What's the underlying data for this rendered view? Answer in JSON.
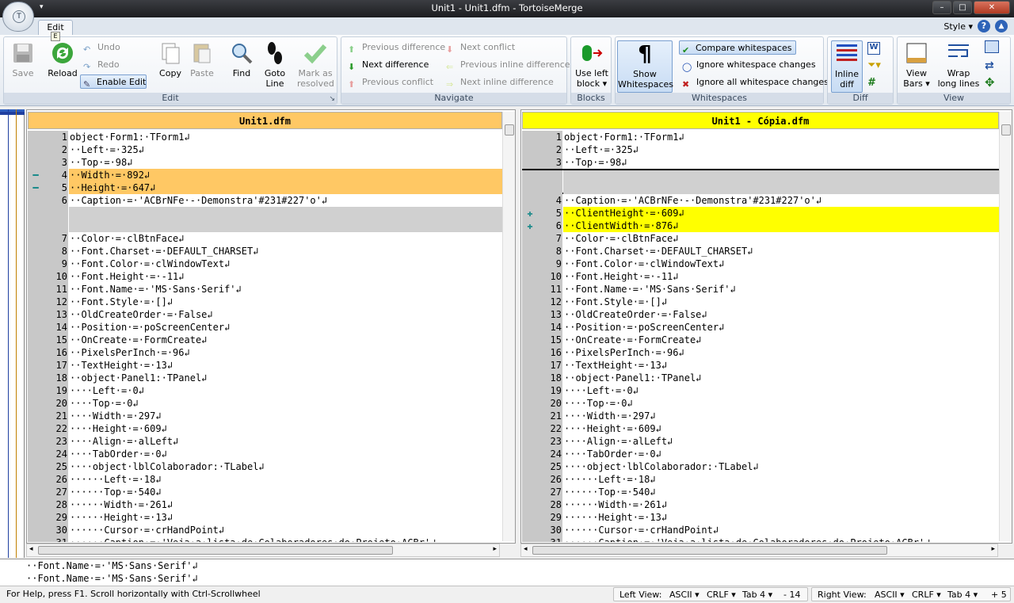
{
  "window": {
    "title": "Unit1 - Unit1.dfm - TortoiseMerge",
    "minimize": "–",
    "maximize": "□",
    "close": "✕"
  },
  "app_button": {
    "letter": "T",
    "qat": "▾"
  },
  "tabs": {
    "edit": "Edit",
    "keytip": "E"
  },
  "style_menu": "Style ▾",
  "ribbon": {
    "edit": {
      "label": "Edit",
      "save": "Save",
      "reload": "Reload",
      "undo": "Undo",
      "redo": "Redo",
      "enable_edit": "Enable Edit",
      "copy": "Copy",
      "paste": "Paste",
      "find": "Find",
      "goto": "Goto",
      "goto2": "Line",
      "mark": "Mark as",
      "mark2": "resolved",
      "launcher": "↘"
    },
    "navigate": {
      "label": "Navigate",
      "prev_diff": "Previous difference",
      "next_diff": "Next difference",
      "prev_conflict": "Previous conflict",
      "next_conflict": "Next conflict",
      "prev_inline": "Previous inline difference",
      "next_inline": "Next inline difference"
    },
    "blocks": {
      "label": "Blocks",
      "use_left": "Use left",
      "use_left2": "block ▾"
    },
    "whitespaces": {
      "label": "Whitespaces",
      "show": "Show",
      "show2": "Whitespaces",
      "compare": "Compare whitespaces",
      "ignore_changes": "Ignore whitespace changes",
      "ignore_all": "Ignore all whitespace changes"
    },
    "diff": {
      "label": "Diff",
      "inline": "Inline",
      "inline2": "diff"
    },
    "view": {
      "label": "View",
      "viewbars": "View",
      "viewbars2": "Bars ▾",
      "wrap": "Wrap",
      "wrap2": "long lines"
    }
  },
  "left_pane": {
    "filename": "Unit1.dfm",
    "lines": [
      {
        "n": "1",
        "t": "object·Form1:·TForm1↲",
        "k": "n"
      },
      {
        "n": "2",
        "t": "··Left·=·325↲",
        "k": "n"
      },
      {
        "n": "3",
        "t": "··Top·=·98↲",
        "k": "n"
      },
      {
        "n": "4",
        "t": "··Width·=·892↲",
        "k": "r",
        "m": "━"
      },
      {
        "n": "5",
        "t": "··Height·=·647↲",
        "k": "r",
        "m": "━"
      },
      {
        "n": "6",
        "t": "··Caption·=·'ACBrNFe·-·Demonstra'#231#227'o'↲",
        "k": "n"
      },
      {
        "n": "",
        "t": "",
        "k": "f"
      },
      {
        "n": "",
        "t": "",
        "k": "f"
      },
      {
        "n": "7",
        "t": "··Color·=·clBtnFace↲",
        "k": "n"
      },
      {
        "n": "8",
        "t": "··Font.Charset·=·DEFAULT_CHARSET↲",
        "k": "n"
      },
      {
        "n": "9",
        "t": "··Font.Color·=·clWindowText↲",
        "k": "n"
      },
      {
        "n": "10",
        "t": "··Font.Height·=·-11↲",
        "k": "n"
      },
      {
        "n": "11",
        "t": "··Font.Name·=·'MS·Sans·Serif'↲",
        "k": "n"
      },
      {
        "n": "12",
        "t": "··Font.Style·=·[]↲",
        "k": "n"
      },
      {
        "n": "13",
        "t": "··OldCreateOrder·=·False↲",
        "k": "n"
      },
      {
        "n": "14",
        "t": "··Position·=·poScreenCenter↲",
        "k": "n"
      },
      {
        "n": "15",
        "t": "··OnCreate·=·FormCreate↲",
        "k": "n"
      },
      {
        "n": "16",
        "t": "··PixelsPerInch·=·96↲",
        "k": "n"
      },
      {
        "n": "17",
        "t": "··TextHeight·=·13↲",
        "k": "n"
      },
      {
        "n": "18",
        "t": "··object·Panel1:·TPanel↲",
        "k": "n"
      },
      {
        "n": "19",
        "t": "····Left·=·0↲",
        "k": "n"
      },
      {
        "n": "20",
        "t": "····Top·=·0↲",
        "k": "n"
      },
      {
        "n": "21",
        "t": "····Width·=·297↲",
        "k": "n"
      },
      {
        "n": "22",
        "t": "····Height·=·609↲",
        "k": "n"
      },
      {
        "n": "23",
        "t": "····Align·=·alLeft↲",
        "k": "n"
      },
      {
        "n": "24",
        "t": "····TabOrder·=·0↲",
        "k": "n"
      },
      {
        "n": "25",
        "t": "····object·lblColaborador:·TLabel↲",
        "k": "n"
      },
      {
        "n": "26",
        "t": "······Left·=·18↲",
        "k": "n"
      },
      {
        "n": "27",
        "t": "······Top·=·540↲",
        "k": "n"
      },
      {
        "n": "28",
        "t": "······Width·=·261↲",
        "k": "n"
      },
      {
        "n": "29",
        "t": "······Height·=·13↲",
        "k": "n"
      },
      {
        "n": "30",
        "t": "······Cursor·=·crHandPoint↲",
        "k": "n"
      },
      {
        "n": "31",
        "t": "······Caption·=·'Veja·a·lista·de·Colaboradores·do·Projeto·ACBr'↲",
        "k": "n"
      }
    ]
  },
  "right_pane": {
    "filename": "Unit1 - Cópia.dfm",
    "lines": [
      {
        "n": "1",
        "t": "object·Form1:·TForm1↲",
        "k": "n"
      },
      {
        "n": "2",
        "t": "··Left·=·325↲",
        "k": "n"
      },
      {
        "n": "3",
        "t": "··Top·=·98↲",
        "k": "n"
      },
      {
        "n": "",
        "t": "",
        "k": "f"
      },
      {
        "n": "",
        "t": "",
        "k": "f"
      },
      {
        "n": "4",
        "t": "··Caption·=·'ACBrNFe·-·Demonstra'#231#227'o'↲",
        "k": "n"
      },
      {
        "n": "5",
        "t": "··ClientHeight·=·609↲",
        "k": "a",
        "m": "✚"
      },
      {
        "n": "6",
        "t": "··ClientWidth·=·876↲",
        "k": "a",
        "m": "✚"
      },
      {
        "n": "7",
        "t": "··Color·=·clBtnFace↲",
        "k": "n"
      },
      {
        "n": "8",
        "t": "··Font.Charset·=·DEFAULT_CHARSET↲",
        "k": "n"
      },
      {
        "n": "9",
        "t": "··Font.Color·=·clWindowText↲",
        "k": "n"
      },
      {
        "n": "10",
        "t": "··Font.Height·=·-11↲",
        "k": "n"
      },
      {
        "n": "11",
        "t": "··Font.Name·=·'MS·Sans·Serif'↲",
        "k": "n"
      },
      {
        "n": "12",
        "t": "··Font.Style·=·[]↲",
        "k": "n"
      },
      {
        "n": "13",
        "t": "··OldCreateOrder·=·False↲",
        "k": "n"
      },
      {
        "n": "14",
        "t": "··Position·=·poScreenCenter↲",
        "k": "n"
      },
      {
        "n": "15",
        "t": "··OnCreate·=·FormCreate↲",
        "k": "n"
      },
      {
        "n": "16",
        "t": "··PixelsPerInch·=·96↲",
        "k": "n"
      },
      {
        "n": "17",
        "t": "··TextHeight·=·13↲",
        "k": "n"
      },
      {
        "n": "18",
        "t": "··object·Panel1:·TPanel↲",
        "k": "n"
      },
      {
        "n": "19",
        "t": "····Left·=·0↲",
        "k": "n"
      },
      {
        "n": "20",
        "t": "····Top·=·0↲",
        "k": "n"
      },
      {
        "n": "21",
        "t": "····Width·=·297↲",
        "k": "n"
      },
      {
        "n": "22",
        "t": "····Height·=·609↲",
        "k": "n"
      },
      {
        "n": "23",
        "t": "····Align·=·alLeft↲",
        "k": "n"
      },
      {
        "n": "24",
        "t": "····TabOrder·=·0↲",
        "k": "n"
      },
      {
        "n": "25",
        "t": "····object·lblColaborador:·TLabel↲",
        "k": "n"
      },
      {
        "n": "26",
        "t": "······Left·=·18↲",
        "k": "n"
      },
      {
        "n": "27",
        "t": "······Top·=·540↲",
        "k": "n"
      },
      {
        "n": "28",
        "t": "······Width·=·261↲",
        "k": "n"
      },
      {
        "n": "29",
        "t": "······Height·=·13↲",
        "k": "n"
      },
      {
        "n": "30",
        "t": "······Cursor·=·crHandPoint↲",
        "k": "n"
      },
      {
        "n": "31",
        "t": "······Caption·=·'Veja·a·lista·de·Colaboradores·do·Projeto·ACBr'↲",
        "k": "n"
      }
    ]
  },
  "bottom_lines": [
    "··Font.Name·=·'MS·Sans·Serif'↲",
    "··Font.Name·=·'MS·Sans·Serif'↲"
  ],
  "status": {
    "help": "For Help, press F1. Scroll horizontally with Ctrl-Scrollwheel",
    "left_view": "Left View:",
    "left_enc": "ASCII ▾",
    "left_eol": "CRLF ▾",
    "left_tab": "Tab 4 ▾",
    "left_count": "- 14",
    "right_view": "Right View:",
    "right_enc": "ASCII ▾",
    "right_eol": "CRLF ▾",
    "right_tab": "Tab 4 ▾",
    "right_count": "+ 5"
  },
  "colors": {
    "removed": "#ffc864",
    "added": "#ffff00",
    "filler": "#d0d0d0",
    "left_header": "#ffc864",
    "right_header": "#ffff00"
  }
}
